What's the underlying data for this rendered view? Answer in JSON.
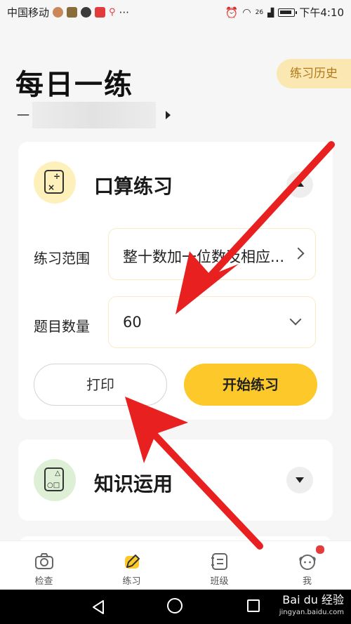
{
  "status_bar": {
    "carrier": "中国移动",
    "time": "下午4:10",
    "signal_badge": "26",
    "notif_colors": [
      "#c9885a",
      "#8a6b3a",
      "#3b3b3b",
      "#e23b3b"
    ]
  },
  "header": {
    "title": "每日一练",
    "history_button": "练习历史",
    "subtitle_prefix": "一"
  },
  "card_oral": {
    "title": "口算练习",
    "range_label": "练习范围",
    "range_value": "整十数加一位数及相应...",
    "count_label": "题目数量",
    "count_value": "60",
    "print_button": "打印",
    "start_button": "开始练习",
    "icon": "calculator-icon"
  },
  "card_knowledge": {
    "title": "知识运用",
    "icon": "shapes-icon"
  },
  "tabbar": {
    "tabs": [
      {
        "label": "检查",
        "icon": "camera-icon"
      },
      {
        "label": "练习",
        "icon": "pencil-icon"
      },
      {
        "label": "班级",
        "icon": "class-list-icon"
      },
      {
        "label": "我",
        "icon": "avatar-icon"
      }
    ]
  },
  "watermark": {
    "brand": "Bai du 经验",
    "site": "jingyan.baidu.com"
  },
  "colors": {
    "accent_yellow": "#fcc82a",
    "history_bg": "#fbe7b1",
    "arrow_red": "#e8201f"
  }
}
